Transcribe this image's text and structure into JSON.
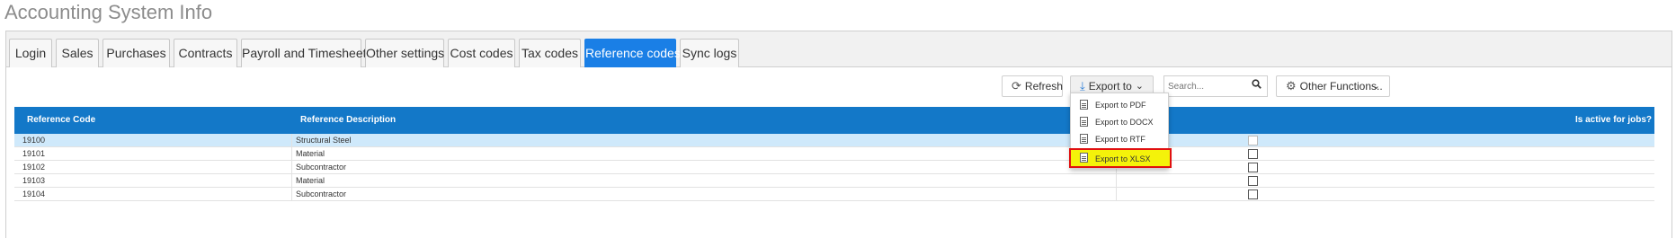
{
  "page": {
    "title": "Accounting System Info"
  },
  "tabs": [
    {
      "label": "Login"
    },
    {
      "label": "Sales"
    },
    {
      "label": "Purchases"
    },
    {
      "label": "Contracts"
    },
    {
      "label": "Payroll and Timesheets"
    },
    {
      "label": "Other settings"
    },
    {
      "label": "Cost codes"
    },
    {
      "label": "Tax codes"
    },
    {
      "label": "Reference codes",
      "active": true
    },
    {
      "label": "Sync logs"
    }
  ],
  "toolbar": {
    "refresh_label": "Refresh",
    "export_label": "Export to",
    "search_placeholder": "Search...",
    "other_functions_label": "Other Functions.."
  },
  "export_menu": {
    "items": [
      {
        "label": "Export to PDF"
      },
      {
        "label": "Export to DOCX"
      },
      {
        "label": "Export to RTF"
      },
      {
        "label": "Export to XLSX",
        "highlighted": true
      }
    ]
  },
  "table": {
    "columns": [
      "Reference Code",
      "Reference Description",
      "Is active for jobs?"
    ],
    "rows": [
      {
        "code": "19100",
        "description": "Structural Steel",
        "active": false,
        "selected": true
      },
      {
        "code": "19101",
        "description": "Material",
        "active": false
      },
      {
        "code": "19102",
        "description": "Subcontractor",
        "active": false
      },
      {
        "code": "19103",
        "description": "Material",
        "active": false
      },
      {
        "code": "19104",
        "description": "Subcontractor",
        "active": false
      }
    ]
  },
  "colors": {
    "accent": "#1a7fe6",
    "table_header": "#1378c8",
    "selected_row": "#cfe9fb",
    "highlight_fill": "#f4f20a",
    "highlight_border": "#e01010"
  }
}
